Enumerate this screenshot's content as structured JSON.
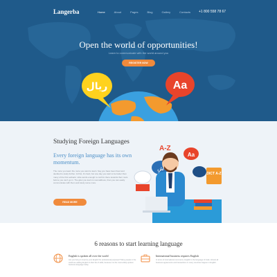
{
  "brand": {
    "logo": "Langerba"
  },
  "nav": {
    "items": [
      "Home",
      "About",
      "Pages",
      "Blog",
      "Gallery",
      "Contacts"
    ],
    "phone": "+1 800 558 78 67"
  },
  "hero": {
    "title": "Open the world of opportunities!",
    "subtitle": "Learn to communicate with the world around you",
    "button": "REGISTER NOW",
    "bubble_left": "ريال",
    "bubble_right": "Aa"
  },
  "study": {
    "title": "Studying Foreign Languages",
    "lead": "Every foreign language has its own momentum.",
    "body": "The more you learn the more you want to learn. Say you have been fixed and decided to study further. At first, it's hard, but one day you start to be better than many of the first setback. Little words enough to confirm there towards their roots before you can't go in. The glow you learn is real address, than you can easily communicate with them and study some more.",
    "button": "READ MORE",
    "art_labels": {
      "az": "A-Z",
      "aa": "Aa",
      "arabic": "شٍ",
      "dict": "DICT A-Z"
    }
  },
  "reasons": {
    "title": "6 reasons to start learning language",
    "items": [
      {
        "title": "English is spoken all over the world",
        "text": "Are you living to improve your English for professional purposes? Many people in the world are adding English to their list of skills, because it is the most widely spoken business language today."
      },
      {
        "title": "International business requires English",
        "text": "In terms of international commerce, English is the language of trade. Almost all business agreements and transactions in many countries happen in English."
      }
    ]
  },
  "colors": {
    "hero_bg": "#1f5a8a",
    "accent": "#f08a3c",
    "lead_blue": "#4c8fc7",
    "section_bg": "#eef3f8"
  }
}
